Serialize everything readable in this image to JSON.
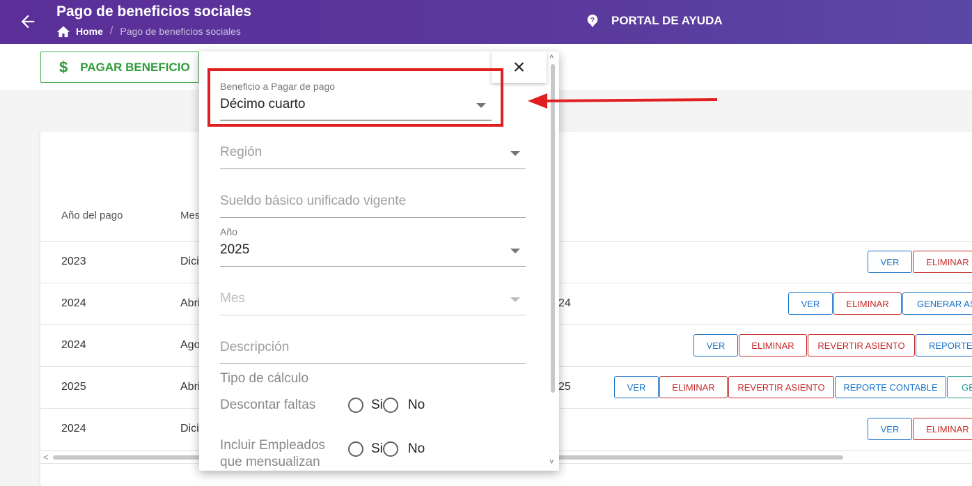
{
  "header": {
    "title": "Pago de beneficios sociales",
    "breadcrumb": {
      "home": "Home",
      "separator": "/",
      "current": "Pago de beneficios sociales"
    },
    "help_label": "PORTAL DE AYUDA"
  },
  "toolbar": {
    "pay_label": "PAGAR BENEFICIO",
    "pay_icon": "$"
  },
  "table": {
    "headers": [
      "Año del pago",
      "Mes"
    ],
    "rows": [
      {
        "year": "2023",
        "month": "Dici",
        "extra": "",
        "buttons": [
          "VER",
          "ELIMINAR"
        ]
      },
      {
        "year": "2024",
        "month": "Abri",
        "extra": "24",
        "buttons": [
          "VER",
          "ELIMINAR",
          "GENERAR ASI"
        ]
      },
      {
        "year": "2024",
        "month": "Ago",
        "extra": "",
        "buttons": [
          "VER",
          "ELIMINAR",
          "REVERTIR ASIENTO",
          "REPORTE C"
        ]
      },
      {
        "year": "2025",
        "month": "Abri",
        "extra": "25",
        "buttons": [
          "VER",
          "ELIMINAR",
          "REVERTIR ASIENTO",
          "REPORTE CONTABLE",
          "GE"
        ]
      },
      {
        "year": "2024",
        "month": "Dici",
        "extra": "",
        "buttons": [
          "VER",
          "ELIMINAR"
        ]
      }
    ],
    "scroll_left": "<"
  },
  "dialog": {
    "close_icon": "×",
    "scroll_up": "˄",
    "scroll_down": "˅",
    "beneficio": {
      "label": "Beneficio a Pagar de pago",
      "value": "Décimo cuarto"
    },
    "region": {
      "placeholder": "Región"
    },
    "sueldo": {
      "placeholder": "Sueldo básico unificado vigente"
    },
    "anio": {
      "label": "Año",
      "value": "2025"
    },
    "mes": {
      "placeholder": "Mes"
    },
    "descripcion": {
      "placeholder": "Descripción"
    },
    "tipo_calculo": "Tipo de cálculo",
    "descontar_faltas": {
      "label": "Descontar faltas",
      "yes": "Si",
      "no": "No"
    },
    "incluir": {
      "label_line1": "Incluir Empleados",
      "label_line2": "que mensualizan",
      "yes": "Si",
      "no": "No"
    }
  },
  "colors": {
    "header": "#5b2e98",
    "success": "#2e9b3a",
    "danger": "#c62828",
    "primary": "#1a73c9",
    "annotation": "#e02020"
  }
}
